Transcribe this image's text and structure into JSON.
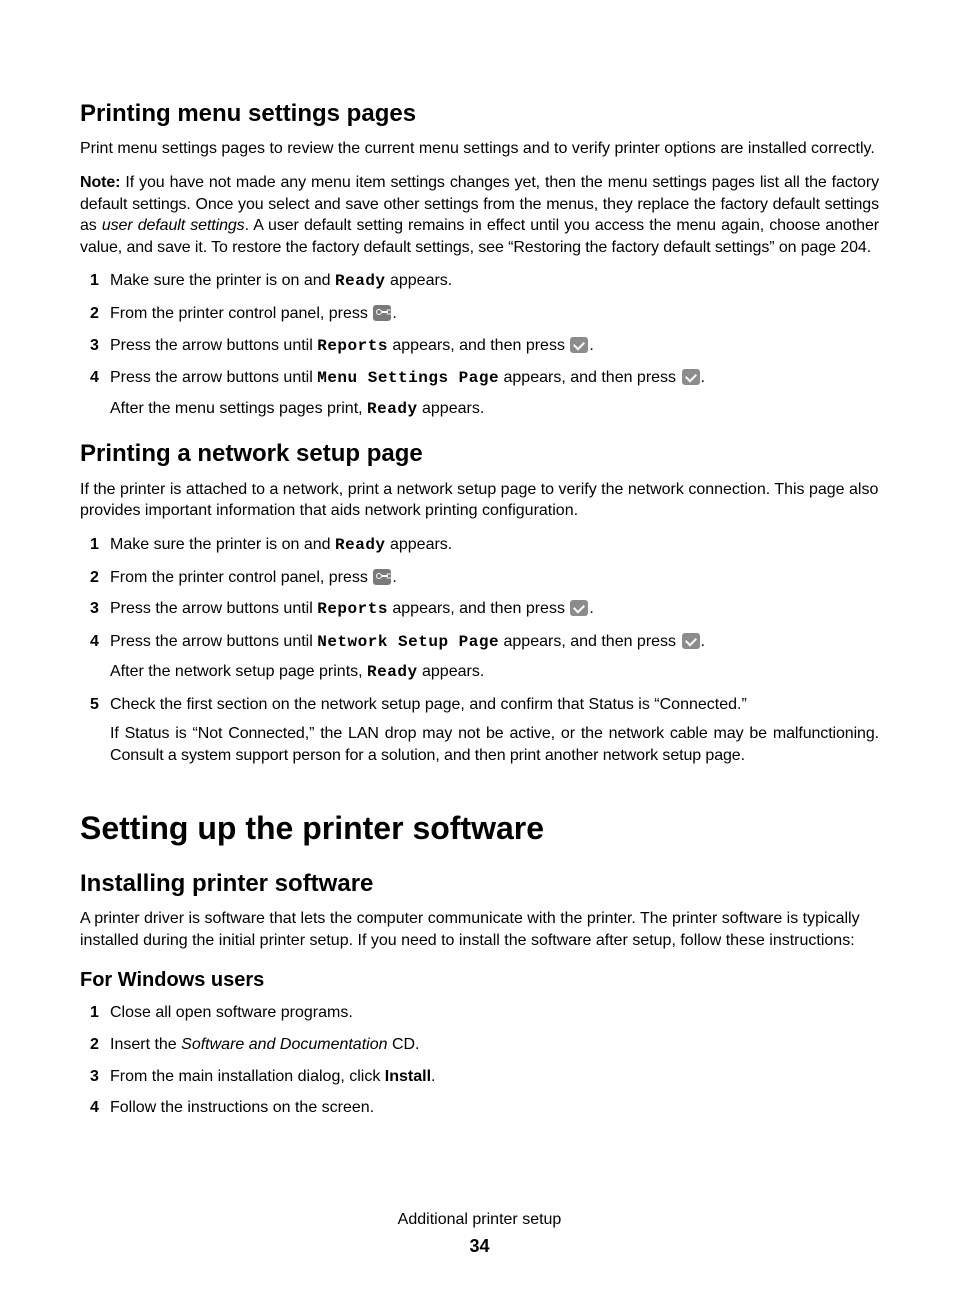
{
  "sec1": {
    "heading": "Printing menu settings pages",
    "p1": "Print menu settings pages to review the current menu settings and to verify printer options are installed correctly.",
    "note_label": "Note:",
    "note_a": " If you have not made any menu item settings changes yet, then the menu settings pages list all the factory default settings. Once you select and save other settings from the menus, they replace the factory default settings as ",
    "note_ital": "user default settings",
    "note_b": ". A user default setting remains in effect until you access the menu again, choose another value, and save it. To restore the factory default settings, see “Restoring the factory default settings” on page 204.",
    "steps": {
      "s1a": "Make sure the printer is on and ",
      "s1_mono": "Ready",
      "s1b": " appears.",
      "s2a": "From the printer control panel, press ",
      "s2b": ".",
      "s3a": "Press the arrow buttons until ",
      "s3_mono": "Reports",
      "s3b": " appears, and then press ",
      "s3c": ".",
      "s4a": "Press the arrow buttons until ",
      "s4_mono": "Menu Settings Page",
      "s4b": " appears, and then press ",
      "s4c": ".",
      "s4_after_a": "After the menu settings pages print, ",
      "s4_after_mono": "Ready",
      "s4_after_b": " appears."
    }
  },
  "sec2": {
    "heading": "Printing a network setup page",
    "p1": "If the printer is attached to a network, print a network setup page to verify the network connection. This page also provides important information that aids network printing configuration.",
    "steps": {
      "s1a": "Make sure the printer is on and ",
      "s1_mono": "Ready",
      "s1b": " appears.",
      "s2a": "From the printer control panel, press ",
      "s2b": ".",
      "s3a": "Press the arrow buttons until ",
      "s3_mono": "Reports",
      "s3b": " appears, and then press ",
      "s3c": ".",
      "s4a": "Press the arrow buttons until ",
      "s4_mono": "Network Setup Page",
      "s4b": " appears, and then press ",
      "s4c": ".",
      "s4_after_a": "After the network setup page prints, ",
      "s4_after_mono": "Ready",
      "s4_after_b": " appears.",
      "s5": "Check the first section on the network setup page, and confirm that Status is “Connected.”",
      "s5_after": "If Status is “Not Connected,” the LAN drop may not be active, or the network cable may be malfunctioning. Consult a system support person for a solution, and then print another network setup page."
    }
  },
  "sec3": {
    "heading_main": "Setting up the printer software",
    "heading_sub": "Installing printer software",
    "p1": "A printer driver is software that lets the computer communicate with the printer. The printer software is typically installed during the initial printer setup. If you need to install the software after setup, follow these instructions:",
    "win_heading": "For Windows users",
    "steps": {
      "s1": "Close all open software programs.",
      "s2a": "Insert the ",
      "s2_ital": "Software and Documentation",
      "s2b": " CD.",
      "s3a": "From the main installation dialog, click ",
      "s3_bold": "Install",
      "s3b": ".",
      "s4": "Follow the instructions on the screen."
    }
  },
  "footer": {
    "title": "Additional printer setup",
    "page": "34"
  },
  "nums": {
    "n1": "1",
    "n2": "2",
    "n3": "3",
    "n4": "4",
    "n5": "5"
  }
}
